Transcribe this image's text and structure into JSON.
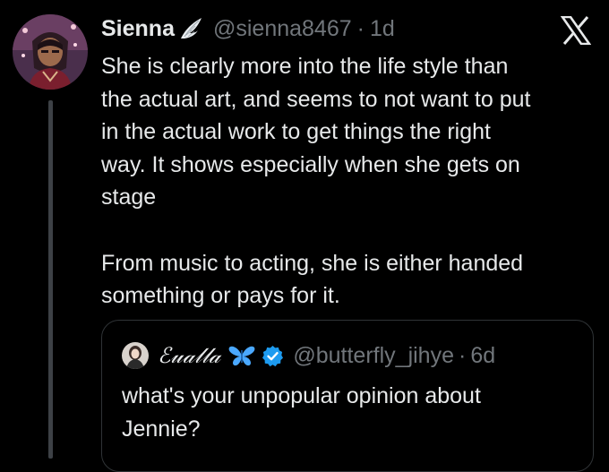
{
  "tweet": {
    "display_name": "Sienna",
    "badge_icon": "wing-icon",
    "handle": "@sienna8467",
    "separator": "·",
    "timestamp": "1d",
    "platform_icon": "x-logo-icon",
    "text_lines": [
      "She is clearly more into the life style than",
      "the actual art, and seems to not want to put",
      "in the actual work to get things the right",
      "way. It shows especially when she gets on",
      "stage"
    ],
    "text_lines_2": [
      "From music to acting, she is either handed",
      "something or pays for it."
    ]
  },
  "quote": {
    "display_name": "ℰ𝓊𝒶𝓁𝓁𝒶",
    "badge_icons": [
      "butterfly-icon",
      "verified-icon"
    ],
    "handle": "@butterfly_jihye",
    "separator": "·",
    "timestamp": "6d",
    "text_lines": [
      "what's your unpopular opinion about",
      "Jennie?"
    ]
  },
  "colors": {
    "background": "#000000",
    "primary_text": "#e7e9ea",
    "secondary_text": "#71767b",
    "border": "#2f3336",
    "verified": "#1d9bf0",
    "butterfly": "#4aa8ff"
  }
}
